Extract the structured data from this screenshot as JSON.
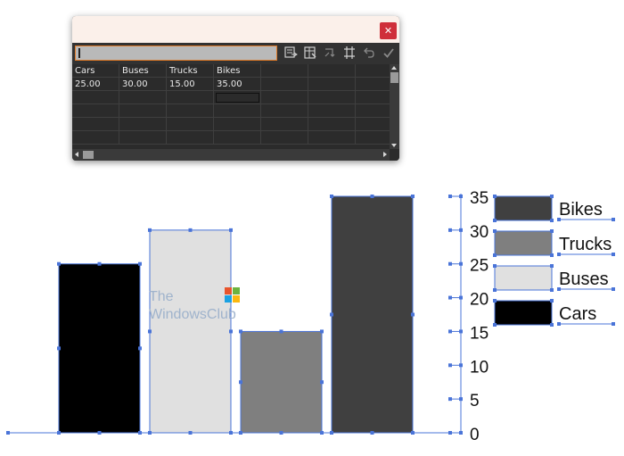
{
  "window": {
    "close_glyph": "✕",
    "input_value": "",
    "toolbar_icons": [
      "import-data-icon",
      "cell-style-icon",
      "transpose-icon",
      "switch-xy-icon",
      "revert-icon",
      "apply-icon"
    ],
    "rows": [
      [
        "Cars",
        "Buses",
        "Trucks",
        "Bikes",
        "",
        "",
        ""
      ],
      [
        "25.00",
        "30.00",
        "15.00",
        "35.00",
        "",
        "",
        ""
      ],
      [
        "",
        "",
        "",
        "",
        "",
        "",
        ""
      ],
      [
        "",
        "",
        "",
        "",
        "",
        "",
        ""
      ],
      [
        "",
        "",
        "",
        "",
        "",
        "",
        ""
      ],
      [
        "",
        "",
        "",
        "",
        "",
        "",
        ""
      ]
    ]
  },
  "watermark": {
    "line1": "The",
    "line2": "WindowsClub"
  },
  "chart_data": {
    "type": "bar",
    "title": "",
    "xlabel": "",
    "ylabel": "",
    "categories": [
      "Cars",
      "Buses",
      "Trucks",
      "Bikes"
    ],
    "values": [
      25,
      30,
      15,
      35
    ],
    "colors": [
      "#000000",
      "#e0e0e0",
      "#7f7f7f",
      "#404040"
    ],
    "ylim": [
      0,
      35
    ],
    "yticks": [
      0,
      5,
      10,
      15,
      20,
      25,
      30,
      35
    ],
    "axis_side": "right",
    "legend_position": "right",
    "legend": [
      {
        "label": "Bikes",
        "color": "#404040"
      },
      {
        "label": "Trucks",
        "color": "#7f7f7f"
      },
      {
        "label": "Buses",
        "color": "#e0e0e0"
      },
      {
        "label": "Cars",
        "color": "#000000"
      }
    ],
    "selection_color": "#4a74d8"
  }
}
